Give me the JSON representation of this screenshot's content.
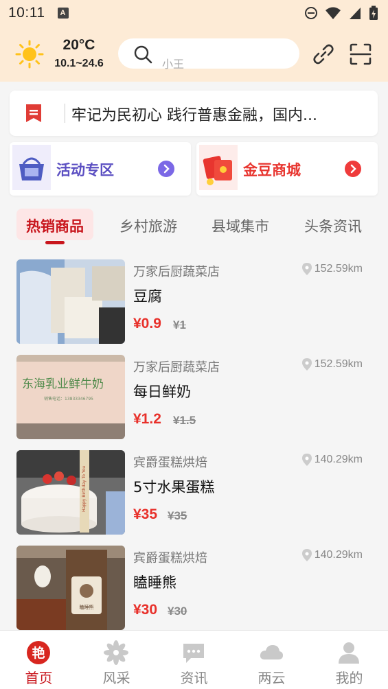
{
  "status_bar": {
    "time": "10:11",
    "indicator": "A"
  },
  "header": {
    "weather_icon": "sun-icon",
    "temperature": "20°C",
    "temp_range": "10.1~24.6",
    "search_placeholder": "小王",
    "link_icon": "link-icon",
    "scan_icon": "scan-icon"
  },
  "notice": {
    "text": "牢记为民初心 践行普惠金融，国内..."
  },
  "promos": [
    {
      "label": "活动专区",
      "icon": "shopping-basket-icon",
      "color": "#5b4fc2"
    },
    {
      "label": "金豆商城",
      "icon": "red-envelope-icon",
      "color": "#e8352f"
    }
  ],
  "tabs": [
    {
      "label": "热销商品",
      "active": true
    },
    {
      "label": "乡村旅游",
      "active": false
    },
    {
      "label": "县域集市",
      "active": false
    },
    {
      "label": "头条资讯",
      "active": false
    }
  ],
  "products": [
    {
      "shop": "万家后厨蔬菜店",
      "distance": "152.59km",
      "name": "豆腐",
      "price": "¥0.9",
      "original_price": "¥1"
    },
    {
      "shop": "万家后厨蔬菜店",
      "distance": "152.59km",
      "name": "每日鲜奶",
      "price": "¥1.2",
      "original_price": "¥1.5"
    },
    {
      "shop": "宾爵蛋糕烘焙",
      "distance": "140.29km",
      "name": "5寸水果蛋糕",
      "price": "¥35",
      "original_price": "¥35"
    },
    {
      "shop": "宾爵蛋糕烘焙",
      "distance": "140.29km",
      "name": "瞌睡熊",
      "price": "¥30",
      "original_price": "¥30"
    }
  ],
  "product_image_text": {
    "milk_bag": "东海乳业鲜牛奶",
    "milk_phone": "销售电话：13833346795",
    "cake_ribbon": "Happy Birthday To You",
    "bear_box": "瞌睡熊"
  },
  "bottom_nav": [
    {
      "label": "首页",
      "icon": "home-logo-icon",
      "active": true,
      "glyph": "艳"
    },
    {
      "label": "风采",
      "icon": "flower-icon",
      "active": false
    },
    {
      "label": "资讯",
      "icon": "chat-bubble-icon",
      "active": false
    },
    {
      "label": "两云",
      "icon": "cloud-icon",
      "active": false
    },
    {
      "label": "我的",
      "icon": "person-icon",
      "active": false
    }
  ],
  "colors": {
    "header_bg": "#fdebd6",
    "brand_red": "#c8161d",
    "price_red": "#e8302a"
  }
}
